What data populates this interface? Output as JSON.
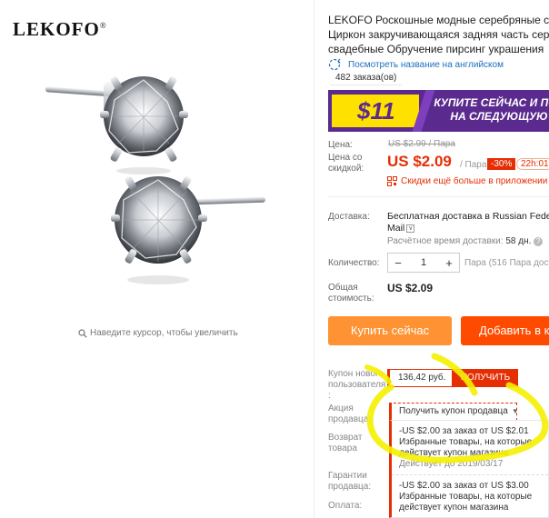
{
  "gallery": {
    "brand_logo": "LEKOFO",
    "brand_mark": "®",
    "zoom_hint": "Наведите курсор, чтобы увеличить"
  },
  "product": {
    "title_lines": [
      "LEKOFO Роскошные модные серебряные сер",
      "Циркон закручивающаяся задняя часть серь",
      "свадебные Обручение пирсинг украшения"
    ],
    "translate_link": "Посмотреть название на английском",
    "orders": "482 заказа(ов)"
  },
  "banner": {
    "price": "$11",
    "text_line1": "КУПИТЕ СЕЙЧАС И ПОЛ",
    "text_line2": "НА СЛЕДУЮЩУЮ"
  },
  "pricing": {
    "price_label": "Цена:",
    "old_price": "US $2.99 / Пара",
    "sale_label": "Цена со скидкой:",
    "sale_price": "US $2.09",
    "unit": "/ Пара",
    "discount": "-30%",
    "timer": "22h:01",
    "app_promo": "Скидки ещё больше в приложении"
  },
  "shipping": {
    "label": "Доставка:",
    "method_line1": "Бесплатная доставка в Russian Federa",
    "method_line2": "Mail",
    "delivery_prefix": "Расчётное время доставки:",
    "delivery_days": "58 дн."
  },
  "quantity": {
    "label": "Количество:",
    "minus": "−",
    "value": "1",
    "plus": "+",
    "note": "Пара (516 Пара доступ"
  },
  "total": {
    "label": "Общая стоимость:",
    "value": "US $2.09"
  },
  "actions": {
    "buy_now": "Купить сейчас",
    "add_to_cart": "Добавить в к"
  },
  "coupons": {
    "new_user_label": "Купон нового пользователя :",
    "new_user_amount": "136,42 руб.",
    "get_button": "ПОЛУЧИТЬ",
    "seller_label": "Акция продавца:",
    "seller_coupon_button": "Получить купон продавца",
    "return_label": "Возврат товара",
    "guarantee_label": "Гарантии продавца:",
    "payment_label": "Оплата:",
    "items": [
      {
        "line1": "-US $2.00 за заказ от US $2.01",
        "line2": "Избранные товары, на которые",
        "line3": "действует купон магазина",
        "valid": "Действует до 2019/03/17"
      },
      {
        "line1": "-US $2.00 за заказ от US $3.00",
        "line2": "Избранные товары, на которые",
        "line3": "действует купон магазина",
        "valid": ""
      }
    ]
  },
  "colors": {
    "accent_red": "#e62e04",
    "buy_orange": "#ff9232",
    "cart_orange": "#ff4b00",
    "banner_purple": "#5b2a8e",
    "banner_yellow": "#ffe100",
    "highlight_yellow": "#f4f000",
    "link_blue": "#1e6fbf"
  }
}
